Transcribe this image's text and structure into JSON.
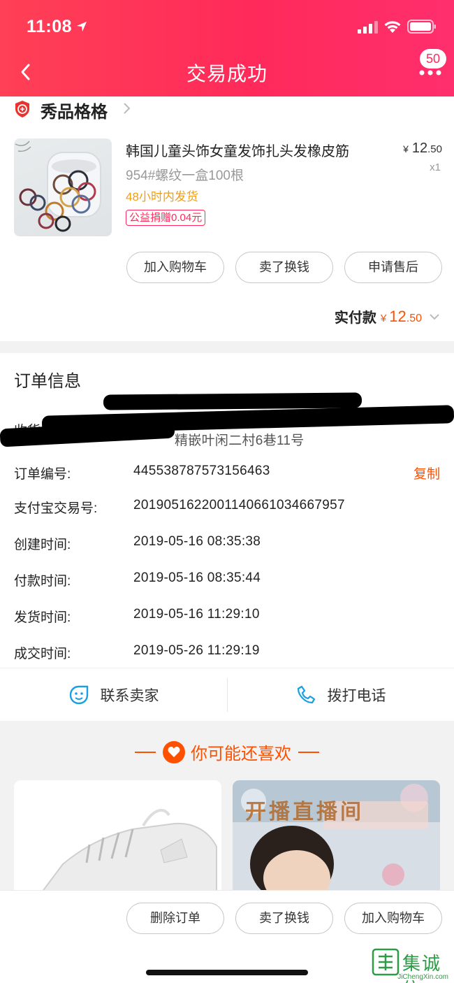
{
  "status": {
    "time": "11:08"
  },
  "nav": {
    "title": "交易成功",
    "badge": "50"
  },
  "shop": {
    "name": "秀品格格"
  },
  "product": {
    "title": "韩国儿童头饰女童发饰扎头发橡皮筋",
    "spec": "954#螺纹一盒100根",
    "ship_note": "48小时内发货",
    "charity": "公益捐赠0.04元",
    "price_symbol": "¥",
    "price_int": "12",
    "price_dec": ".50",
    "qty": "x1"
  },
  "actions": {
    "add_cart": "加入购物车",
    "resell": "卖了换钱",
    "after_sale": "申请售后"
  },
  "payment": {
    "label": "实付款",
    "symbol": "¥",
    "int": "12",
    "dec": ".50"
  },
  "order": {
    "title": "订单信息",
    "receiver_label": "收货信息:",
    "receiver_visible": "精嵌叶闲二村6巷11号",
    "number_label": "订单编号:",
    "number": "445538787573156463",
    "copy": "复制",
    "alipay_label": "支付宝交易号:",
    "alipay": "2019051622001140661034667957",
    "created_label": "创建时间:",
    "created": "2019-05-16 08:35:38",
    "paid_label": "付款时间:",
    "paid": "2019-05-16 08:35:44",
    "shipped_label": "发货时间:",
    "shipped": "2019-05-16 11:29:10",
    "done_label": "成交时间:",
    "done": "2019-05-26 11:29:19"
  },
  "contact": {
    "seller": "联系卖家",
    "phone": "拨打电话"
  },
  "recommend": {
    "title": "你可能还喜欢",
    "banner_text": "开播直播间"
  },
  "bottom": {
    "delete": "删除订单",
    "resell": "卖了换钱",
    "add_cart": "加入购物车"
  },
  "watermark": {
    "text": "集诚信",
    "sub": "JiChengXin.com"
  },
  "colors": {
    "brand": "#ff2a5a",
    "accent": "#ff5000",
    "ship": "#f39c12"
  }
}
